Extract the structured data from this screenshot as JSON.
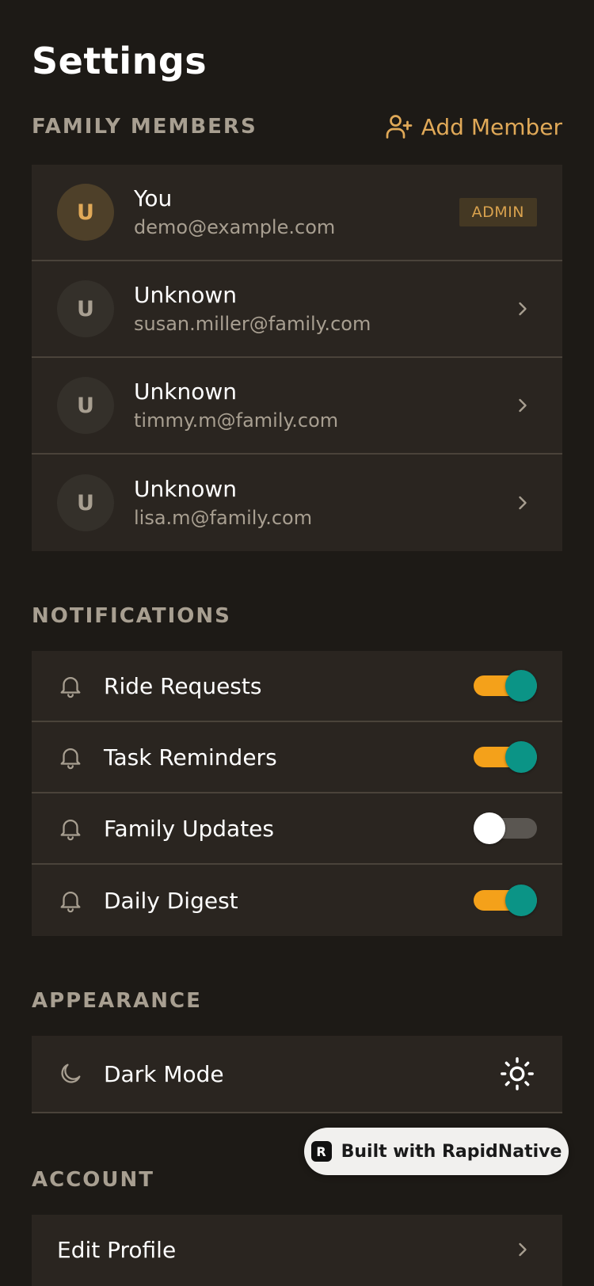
{
  "title": "Settings",
  "family": {
    "section_title": "FAMILY MEMBERS",
    "add_label": "Add Member",
    "members": [
      {
        "initial": "U",
        "name": "You",
        "email": "demo@example.com",
        "badge": "ADMIN"
      },
      {
        "initial": "U",
        "name": "Unknown",
        "email": "susan.miller@family.com"
      },
      {
        "initial": "U",
        "name": "Unknown",
        "email": "timmy.m@family.com"
      },
      {
        "initial": "U",
        "name": "Unknown",
        "email": "lisa.m@family.com"
      }
    ]
  },
  "notifications": {
    "section_title": "NOTIFICATIONS",
    "items": [
      {
        "label": "Ride Requests",
        "enabled": true,
        "icon": "bell-icon"
      },
      {
        "label": "Task Reminders",
        "enabled": true,
        "icon": "bell-icon"
      },
      {
        "label": "Family Updates",
        "enabled": false,
        "icon": "bell-icon"
      },
      {
        "label": "Daily Digest",
        "enabled": true,
        "icon": "bell-icon"
      }
    ]
  },
  "appearance": {
    "section_title": "APPEARANCE",
    "dark_mode_label": "Dark Mode",
    "icon": "moon-icon",
    "toggle_icon": "sun-icon"
  },
  "account": {
    "section_title": "ACCOUNT",
    "items": [
      {
        "label": "Edit Profile"
      }
    ]
  },
  "built_with": {
    "label": "Built with RapidNative",
    "logo": "R"
  },
  "colors": {
    "background": "#1d1a16",
    "card": "#2a2520",
    "accent": "#e0a958",
    "toggle_on_track": "#f4a11a",
    "toggle_on_thumb": "#0b9486",
    "muted_text": "#a89f91"
  }
}
